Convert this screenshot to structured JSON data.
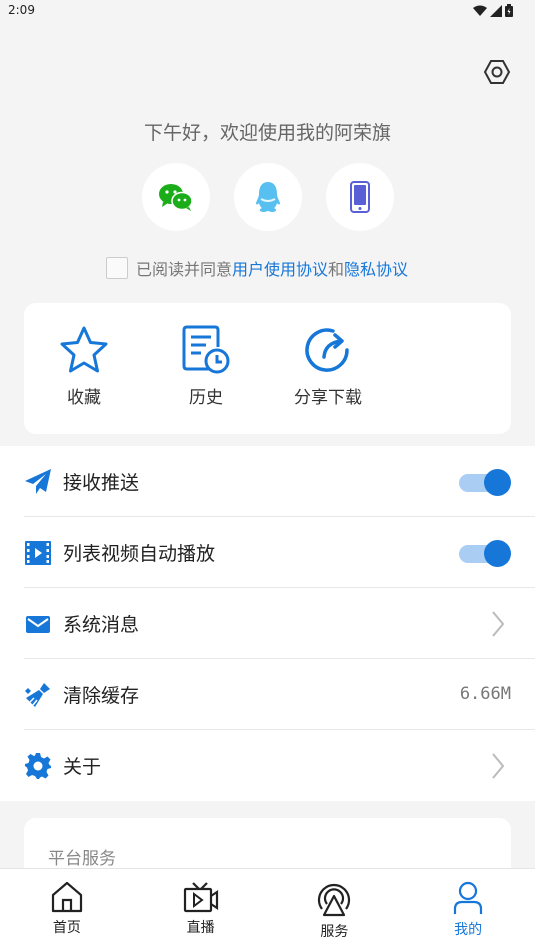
{
  "status_bar": {
    "time": "2:09"
  },
  "greeting": "下午好，欢迎使用我的阿荣旗",
  "login_methods": [
    "wechat-icon",
    "qq-icon",
    "phone-icon"
  ],
  "agreement": {
    "prefix": "已阅读并同意",
    "user_agreement": "用户使用协议",
    "and": "和",
    "privacy_agreement": "隐私协议"
  },
  "quick_actions": [
    {
      "label": "收藏",
      "icon": "star-icon"
    },
    {
      "label": "历史",
      "icon": "history-icon"
    },
    {
      "label": "分享下载",
      "icon": "share-icon"
    }
  ],
  "settings": {
    "push": {
      "label": "接收推送",
      "enabled": true
    },
    "autoplay": {
      "label": "列表视频自动播放",
      "enabled": true
    },
    "messages": {
      "label": "系统消息"
    },
    "cache": {
      "label": "清除缓存",
      "value": "6.66M"
    },
    "about": {
      "label": "关于"
    }
  },
  "platform": {
    "title": "平台服务"
  },
  "nav": {
    "home": "首页",
    "live": "直播",
    "services": "服务",
    "mine": "我的",
    "active": "mine"
  },
  "colors": {
    "accent": "#1677d9",
    "toggle_track": "#a9cdf3",
    "wechat": "#1aad19",
    "qq": "#58c0f0",
    "phone": "#5b5fd6"
  }
}
